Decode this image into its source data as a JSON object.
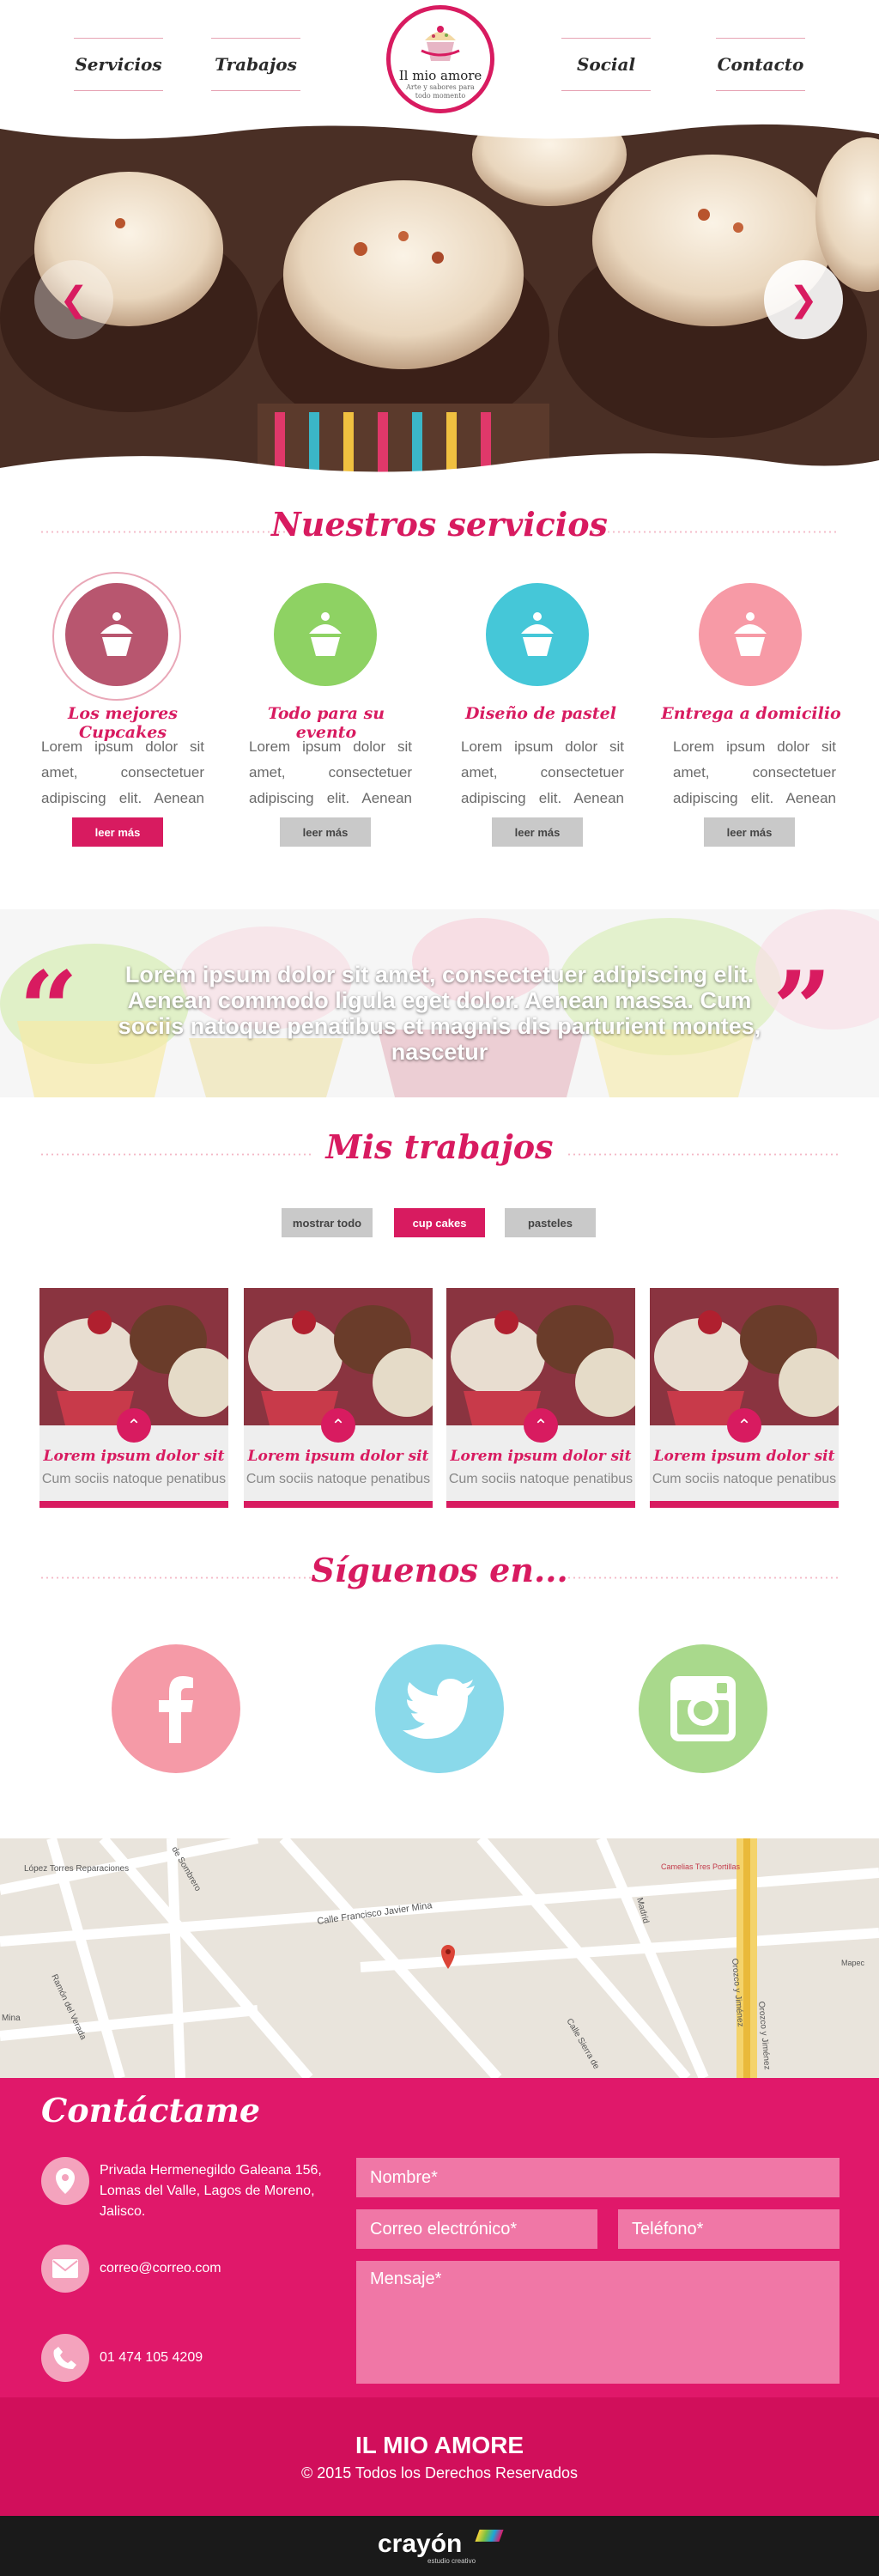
{
  "nav": {
    "items": [
      "Servicios",
      "Trabajos",
      "Social",
      "Contacto"
    ],
    "logo_name": "Il mio amore",
    "logo_tagline": "Arte y sabores para todo momento"
  },
  "hero": {
    "prev_icon": "chevron-left-icon",
    "next_icon": "chevron-right-icon"
  },
  "services": {
    "title": "Nuestros servicios",
    "items": [
      {
        "title": "Los mejores Cupcakes",
        "text": "Lorem ipsum dolor sit amet, consectetuer adipiscing elit. Aenean commodo ligula eget",
        "button": "leer más",
        "color": "#b8566f"
      },
      {
        "title": "Todo para su evento",
        "text": "Lorem ipsum dolor sit amet, consectetuer adipiscing elit. Aenean commodo ligula eget",
        "button": "leer más",
        "color": "#8ed263"
      },
      {
        "title": "Diseño de pastel",
        "text": "Lorem ipsum dolor sit amet, consectetuer adipiscing elit. Aenean commodo ligula eget",
        "button": "leer más",
        "color": "#45c7d8"
      },
      {
        "title": "Entrega a domicilio",
        "text": "Lorem ipsum dolor sit amet, consectetuer adipiscing elit. Aenean commodo ligula eget",
        "button": "leer más",
        "color": "#f79aa6"
      }
    ]
  },
  "quote": {
    "text": "Lorem ipsum dolor sit amet, consectetuer adipiscing elit. Aenean commodo ligula eget dolor. Aenean massa. Cum sociis natoque penatibus et magnis dis parturient montes, nascetur"
  },
  "works": {
    "title": "Mis trabajos",
    "filters": [
      "mostrar todo",
      "cup cakes",
      "pasteles"
    ],
    "active_filter": "cup cakes",
    "items": [
      {
        "title": "Lorem ipsum dolor sit",
        "subtitle": "Cum sociis natoque penatibus"
      },
      {
        "title": "Lorem ipsum dolor sit",
        "subtitle": "Cum sociis natoque penatibus"
      },
      {
        "title": "Lorem ipsum dolor sit",
        "subtitle": "Cum sociis natoque penatibus"
      },
      {
        "title": "Lorem ipsum dolor sit",
        "subtitle": "Cum sociis natoque penatibus"
      }
    ]
  },
  "social": {
    "title": "Síguenos en...",
    "items": [
      {
        "name": "facebook-icon",
        "color": "#f59aa7"
      },
      {
        "name": "twitter-icon",
        "color": "#8ad9ea"
      },
      {
        "name": "instagram-icon",
        "color": "#a9d98c"
      }
    ]
  },
  "map": {
    "labels": [
      "López Torres Reparaciones",
      "de Sombrero",
      "Calle Francisco Javier Mina",
      "Ramón del Verada",
      "Camelias Tres Portillas",
      "Mapec",
      "Orozco y Jiménez",
      "Orozco y Jiménez",
      "Mina",
      "Calle Sierra de",
      "Madrid"
    ]
  },
  "contact": {
    "title": "Contáctame",
    "address": "Privada Hermenegildo Galeana 156, Lomas del Valle, Lagos de Moreno, Jalisco.",
    "email": "correo@correo.com",
    "phone": "01 474 105 4209",
    "placeholders": {
      "name": "Nombre*",
      "email": "Correo electrónico*",
      "phone": "Teléfono*",
      "message": "Mensaje*"
    }
  },
  "footer": {
    "brand": "IL MIO AMORE",
    "copyright": "© 2015 Todos los Derechos Reservados",
    "credit": "crayón",
    "credit_sub": "estudio creativo"
  },
  "colors": {
    "primary": "#d81b60",
    "contact_bg": "#e0186a",
    "footer_bg": "#d10f5b"
  }
}
